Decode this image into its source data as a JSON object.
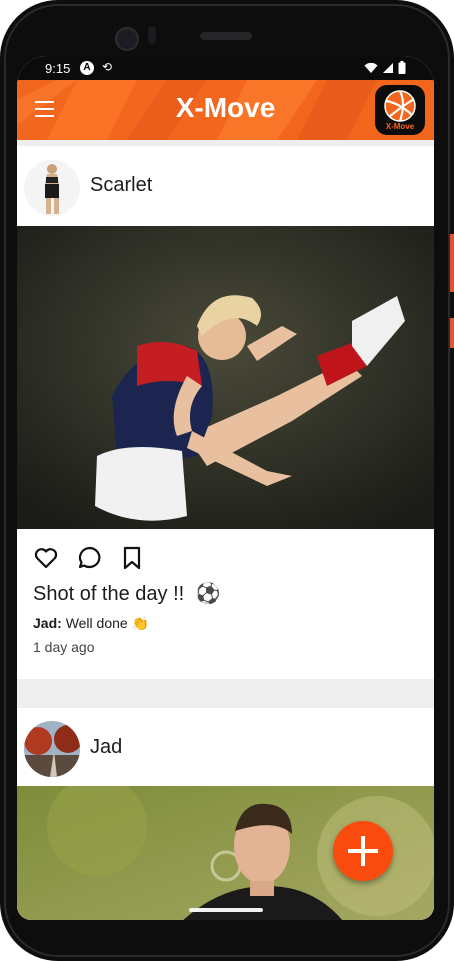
{
  "status_bar": {
    "time": "9:15",
    "left_icons": [
      "android-auto-icon",
      "sync-icon"
    ],
    "right_icons": [
      "wifi-icon",
      "cell-signal-icon",
      "battery-icon"
    ]
  },
  "app_bar": {
    "title": "X-Move",
    "menu_icon": "hamburger-menu-icon",
    "logo_text": "X-Move",
    "accent_color": "#f3661d"
  },
  "posts": [
    {
      "username": "Scarlet",
      "image_desc_icon": "post-photo",
      "caption": "Shot of the day !!",
      "caption_emoji": "⚽",
      "comment_user": "Jad:",
      "comment_text": "Well done 👏",
      "time_ago": "1 day ago"
    },
    {
      "username": "Jad"
    }
  ],
  "fab": {
    "icon": "plus-icon",
    "color": "#fa4b0e"
  }
}
